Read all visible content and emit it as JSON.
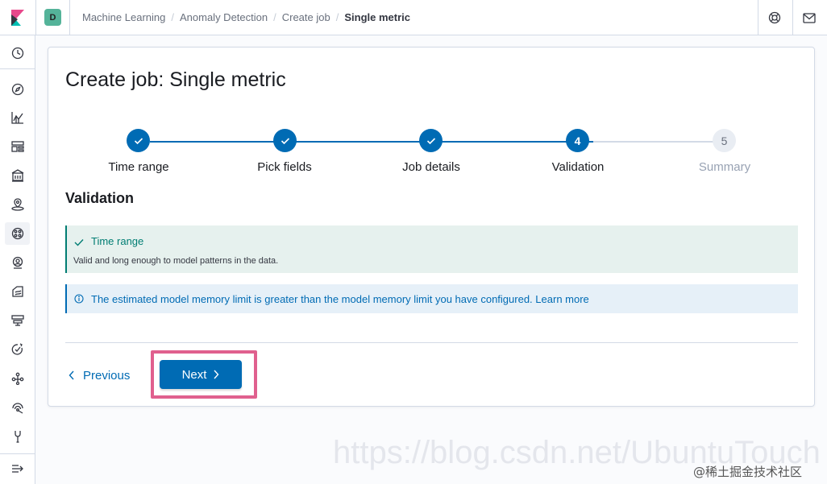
{
  "header": {
    "space_initial": "D",
    "breadcrumbs": [
      "Machine Learning",
      "Anomaly Detection",
      "Create job",
      "Single metric"
    ]
  },
  "sidenav": {
    "items": [
      "clock-icon",
      "compass-icon",
      "visualize-icon",
      "dashboard-icon",
      "canvas-icon",
      "maps-icon",
      "machine-learning-icon",
      "siem-icon",
      "logs-icon",
      "infra-icon",
      "uptime-icon",
      "graph-icon",
      "monitoring-icon",
      "dev-tools-icon",
      "collapse-icon"
    ]
  },
  "page": {
    "title": "Create job: Single metric"
  },
  "stepper": {
    "steps": [
      {
        "label": "Time range",
        "status": "complete",
        "number": "1"
      },
      {
        "label": "Pick fields",
        "status": "complete",
        "number": "2"
      },
      {
        "label": "Job details",
        "status": "complete",
        "number": "3"
      },
      {
        "label": "Validation",
        "status": "current",
        "number": "4"
      },
      {
        "label": "Summary",
        "status": "incomplete",
        "number": "5"
      }
    ]
  },
  "section": {
    "title": "Validation"
  },
  "callouts": {
    "success": {
      "title": "Time range",
      "body": "Valid and long enough to model patterns in the data."
    },
    "info": {
      "text": "The estimated model memory limit is greater than the model memory limit you have configured.",
      "link": "Learn more"
    }
  },
  "footer": {
    "previous_label": "Previous",
    "next_label": "Next"
  },
  "watermark": {
    "url": "https://blog.csdn.net/UbuntuTouch",
    "tag": "@稀土掘金技术社区"
  },
  "colors": {
    "primary": "#006bb4",
    "success": "#017d73",
    "highlight": "#e0608e",
    "space_badge": "#54b399"
  }
}
